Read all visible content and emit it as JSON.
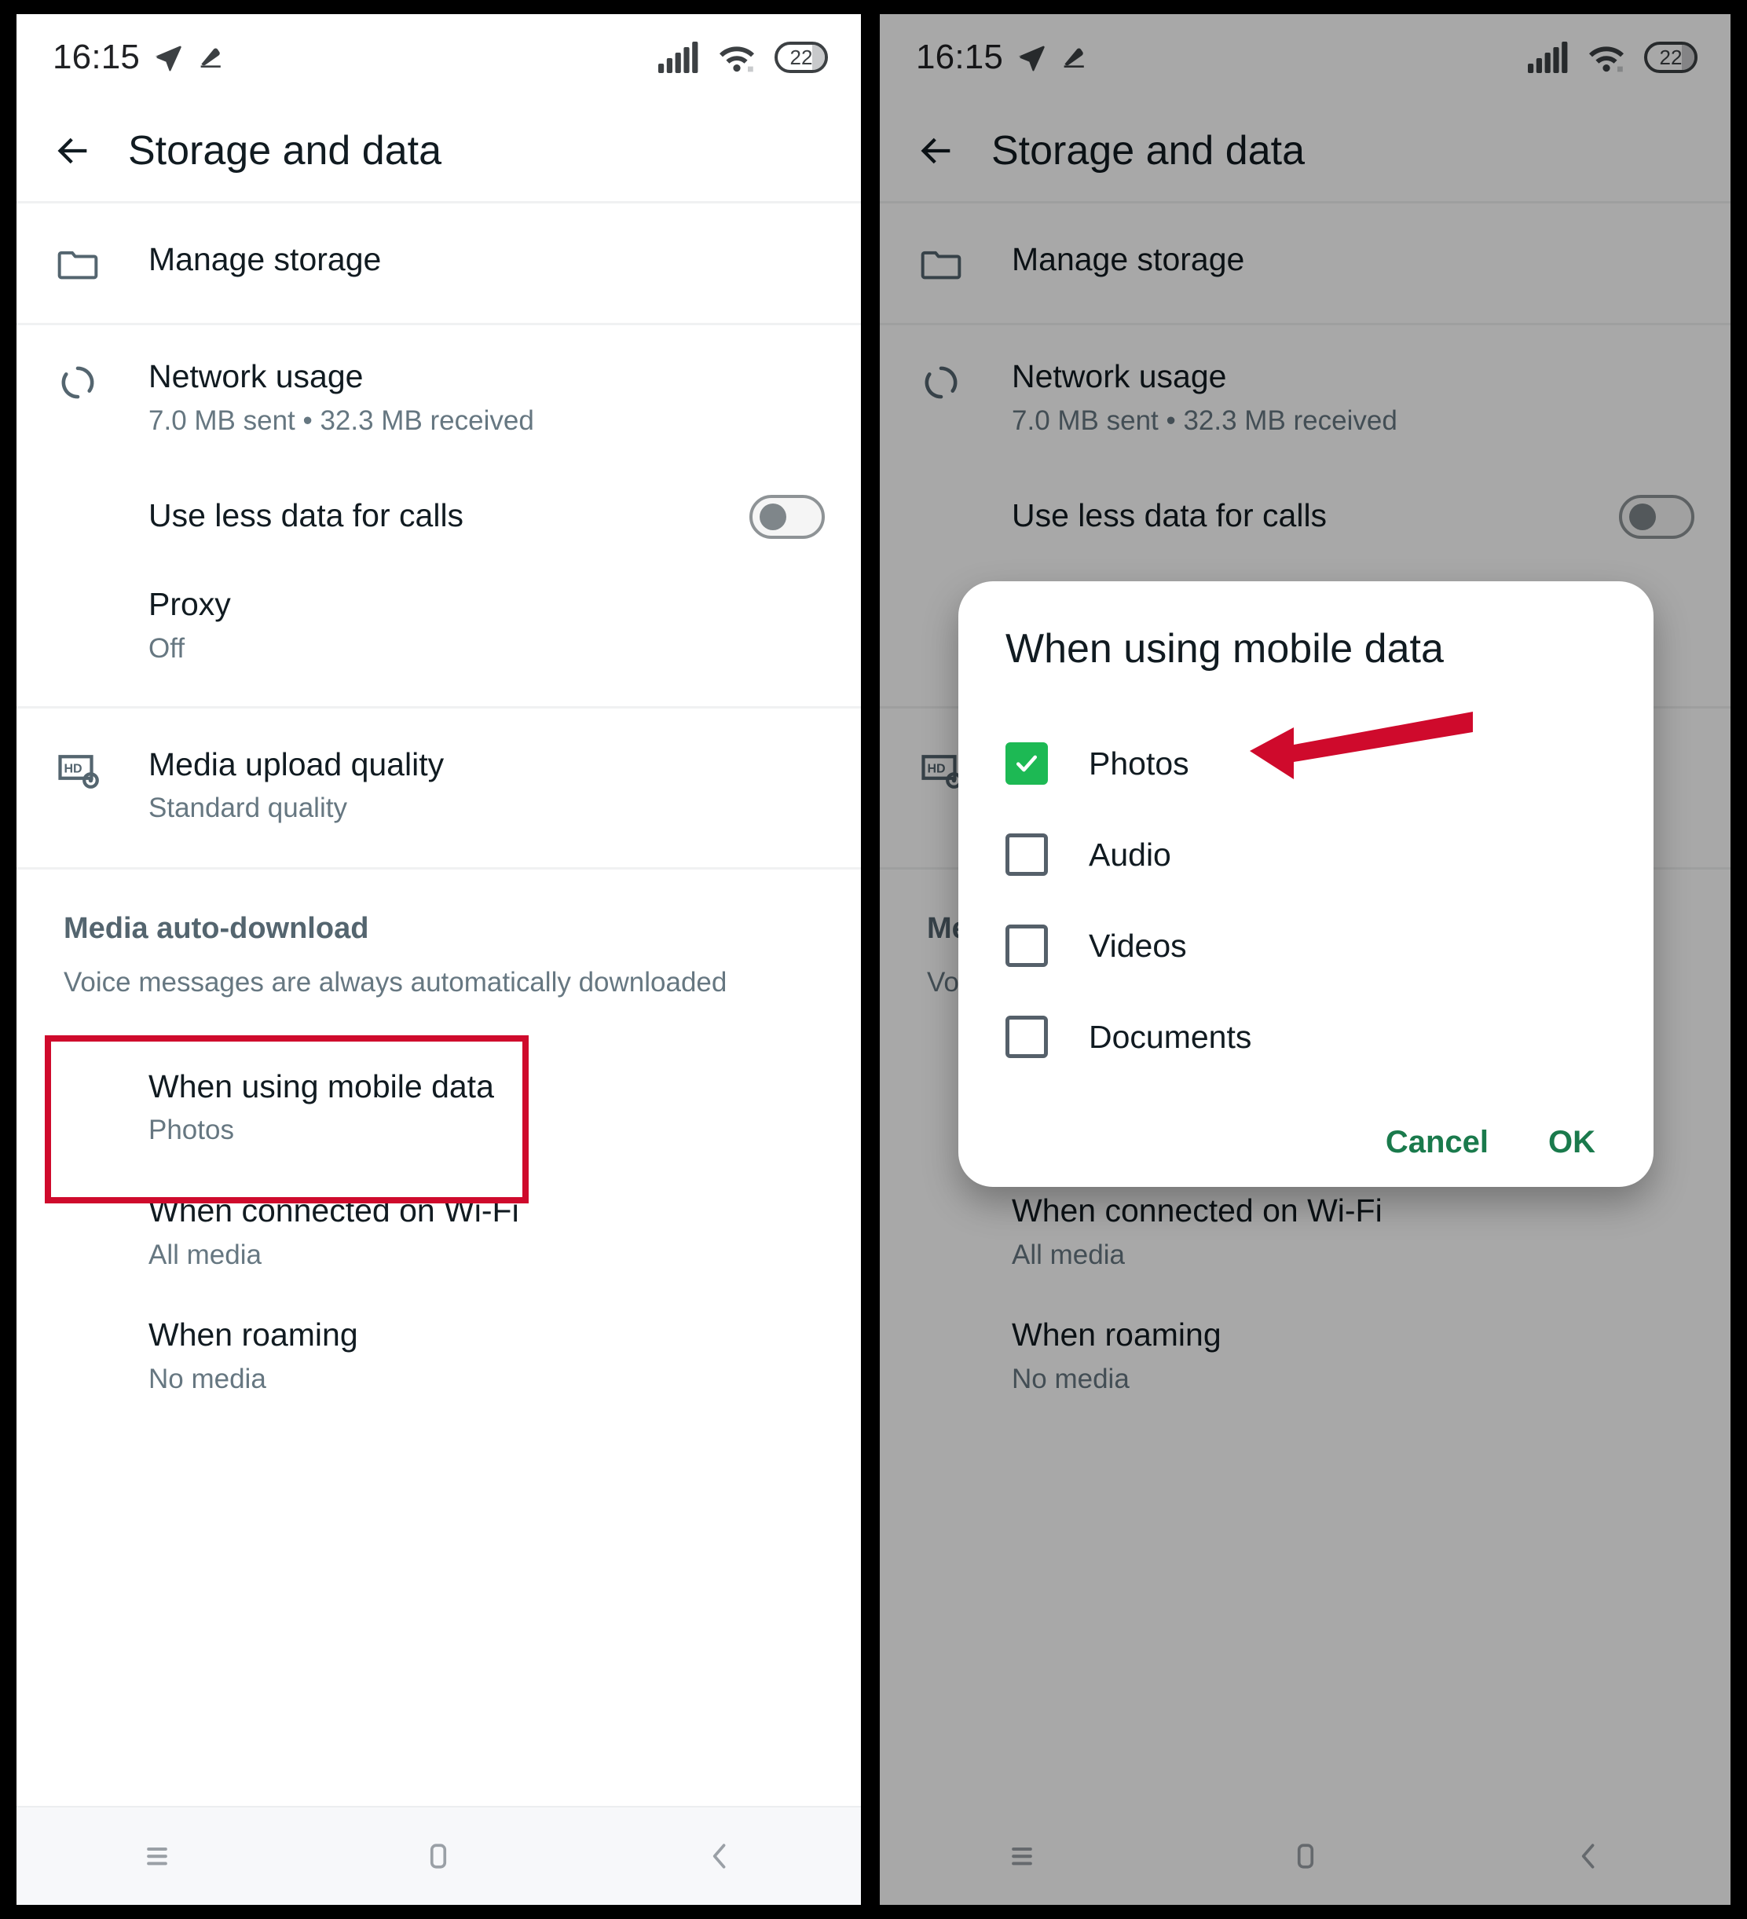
{
  "statusbar": {
    "time": "16:15",
    "icons": [
      "send-icon",
      "mute-icon",
      "signal-icon",
      "wifi-icon"
    ],
    "battery_level": "22"
  },
  "appbar": {
    "title": "Storage and data",
    "back_label": "back-arrow"
  },
  "settings": {
    "manage_storage": {
      "title": "Manage storage",
      "icon": "folder-icon"
    },
    "network_usage": {
      "title": "Network usage",
      "subtitle": "7.0 MB sent • 32.3 MB received",
      "icon": "sync-icon"
    },
    "use_less_data": {
      "title": "Use less data for calls",
      "toggle_state": "off"
    },
    "proxy": {
      "title": "Proxy",
      "subtitle": "Off"
    },
    "media_upload_quality": {
      "title": "Media upload quality",
      "subtitle": "Standard quality",
      "icon": "hd-settings-icon"
    },
    "media_auto_download": {
      "title": "Media auto-download",
      "subtitle": "Voice messages are always automatically downloaded"
    },
    "auto_download_rows": [
      {
        "title": "When using mobile data",
        "subtitle": "Photos"
      },
      {
        "title": "When connected on Wi-Fi",
        "subtitle": "All media"
      },
      {
        "title": "When roaming",
        "subtitle": "No media"
      }
    ]
  },
  "dialog": {
    "title": "When using mobile data",
    "options": [
      {
        "label": "Photos",
        "checked": true
      },
      {
        "label": "Audio",
        "checked": false
      },
      {
        "label": "Videos",
        "checked": false
      },
      {
        "label": "Documents",
        "checked": false
      }
    ],
    "cancel_label": "Cancel",
    "ok_label": "OK"
  },
  "navbar": {
    "recents_label": "recents-icon",
    "home_label": "home-icon",
    "back_label": "back-icon"
  },
  "annotations": {
    "highlight_color": "#cf0a2c",
    "arrow_color": "#cf0a2c",
    "checkbox_checked_color": "#1db954",
    "dialog_action_color": "#1a7a4c"
  }
}
